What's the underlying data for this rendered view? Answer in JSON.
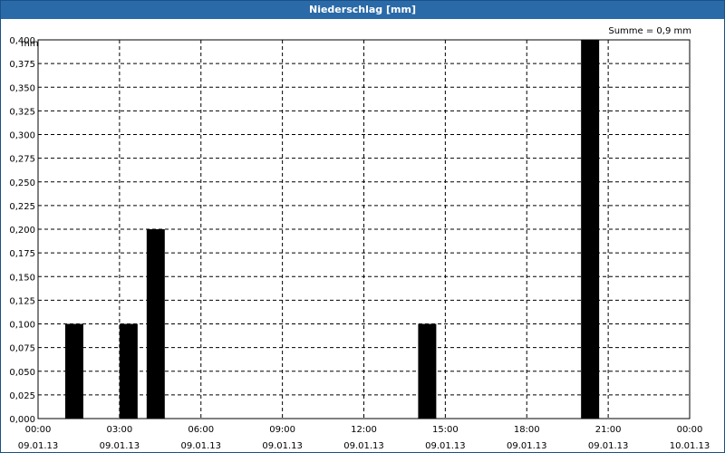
{
  "window": {
    "title": "Niederschlag [mm]"
  },
  "chart_data": {
    "type": "bar",
    "title": "Niederschlag [mm]",
    "annotation": "Summe = 0,9 mm",
    "ylabel": "mm",
    "ylim": [
      0,
      0.4
    ],
    "yticks": [
      "0,000",
      "0,025",
      "0,050",
      "0,075",
      "0,100",
      "0,125",
      "0,150",
      "0,175",
      "0,200",
      "0,225",
      "0,250",
      "0,275",
      "0,300",
      "0,325",
      "0,350",
      "0,375",
      "0,400"
    ],
    "xlim_hours": [
      0,
      24
    ],
    "xticks": [
      {
        "time": "00:00",
        "date": "09.01.13"
      },
      {
        "time": "03:00",
        "date": "09.01.13"
      },
      {
        "time": "06:00",
        "date": "09.01.13"
      },
      {
        "time": "09:00",
        "date": "09.01.13"
      },
      {
        "time": "12:00",
        "date": "09.01.13"
      },
      {
        "time": "15:00",
        "date": "09.01.13"
      },
      {
        "time": "18:00",
        "date": "09.01.13"
      },
      {
        "time": "21:00",
        "date": "09.01.13"
      },
      {
        "time": "00:00",
        "date": "10.01.13"
      }
    ],
    "bars": [
      {
        "start": "01:00",
        "end": "01:40",
        "value": 0.1
      },
      {
        "start": "03:00",
        "end": "03:40",
        "value": 0.1
      },
      {
        "start": "04:00",
        "end": "04:40",
        "value": 0.2
      },
      {
        "start": "14:00",
        "end": "14:40",
        "value": 0.1
      },
      {
        "start": "20:00",
        "end": "20:40",
        "value": 0.4
      }
    ],
    "grid": true,
    "bar_color": "#000000"
  }
}
